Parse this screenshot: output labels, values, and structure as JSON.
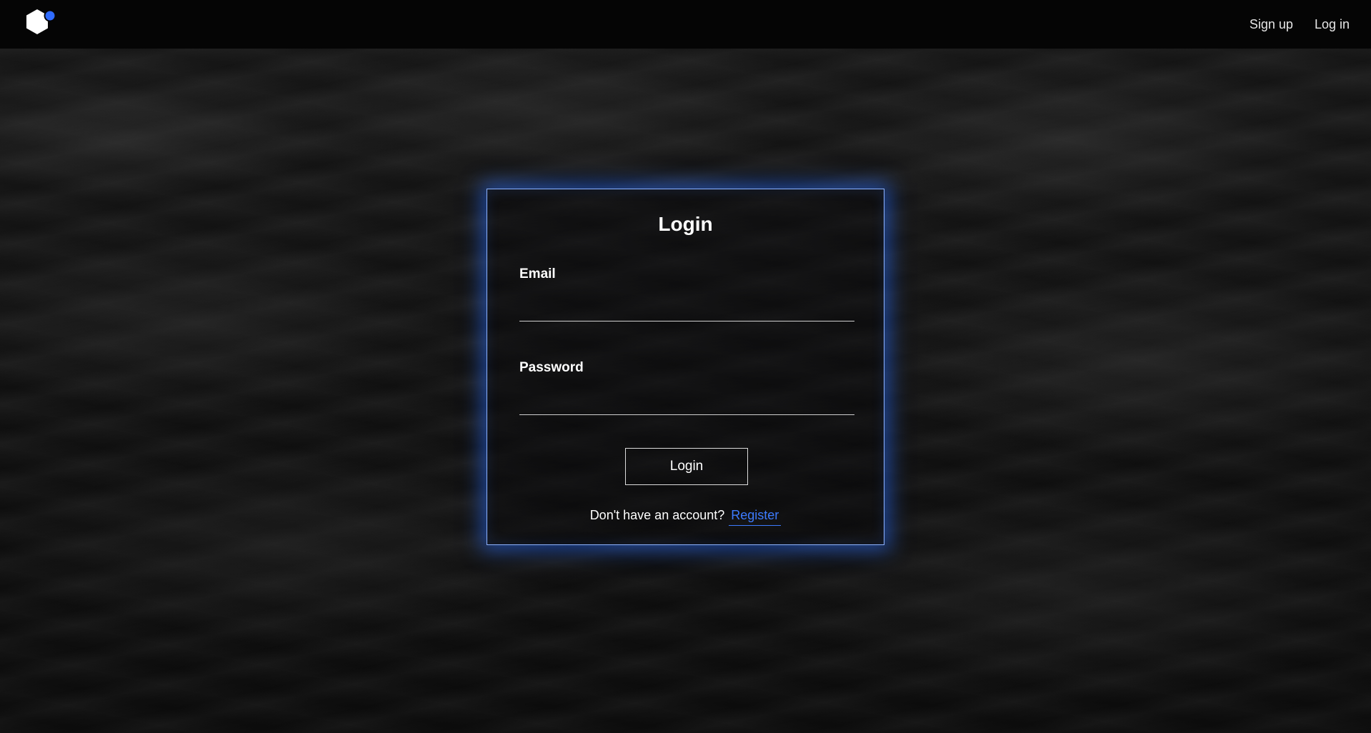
{
  "header": {
    "logo_icon": "hexagon-logo-icon",
    "accent_color": "#2f6bff",
    "nav": {
      "signup_label": "Sign up",
      "login_label": "Log in"
    }
  },
  "login_card": {
    "title": "Login",
    "email": {
      "label": "Email",
      "value": "",
      "placeholder": ""
    },
    "password": {
      "label": "Password",
      "value": "",
      "placeholder": ""
    },
    "submit_label": "Login",
    "register_prompt": "Don't have an account?",
    "register_link": "Register",
    "glow_color": "#2f6bff"
  }
}
